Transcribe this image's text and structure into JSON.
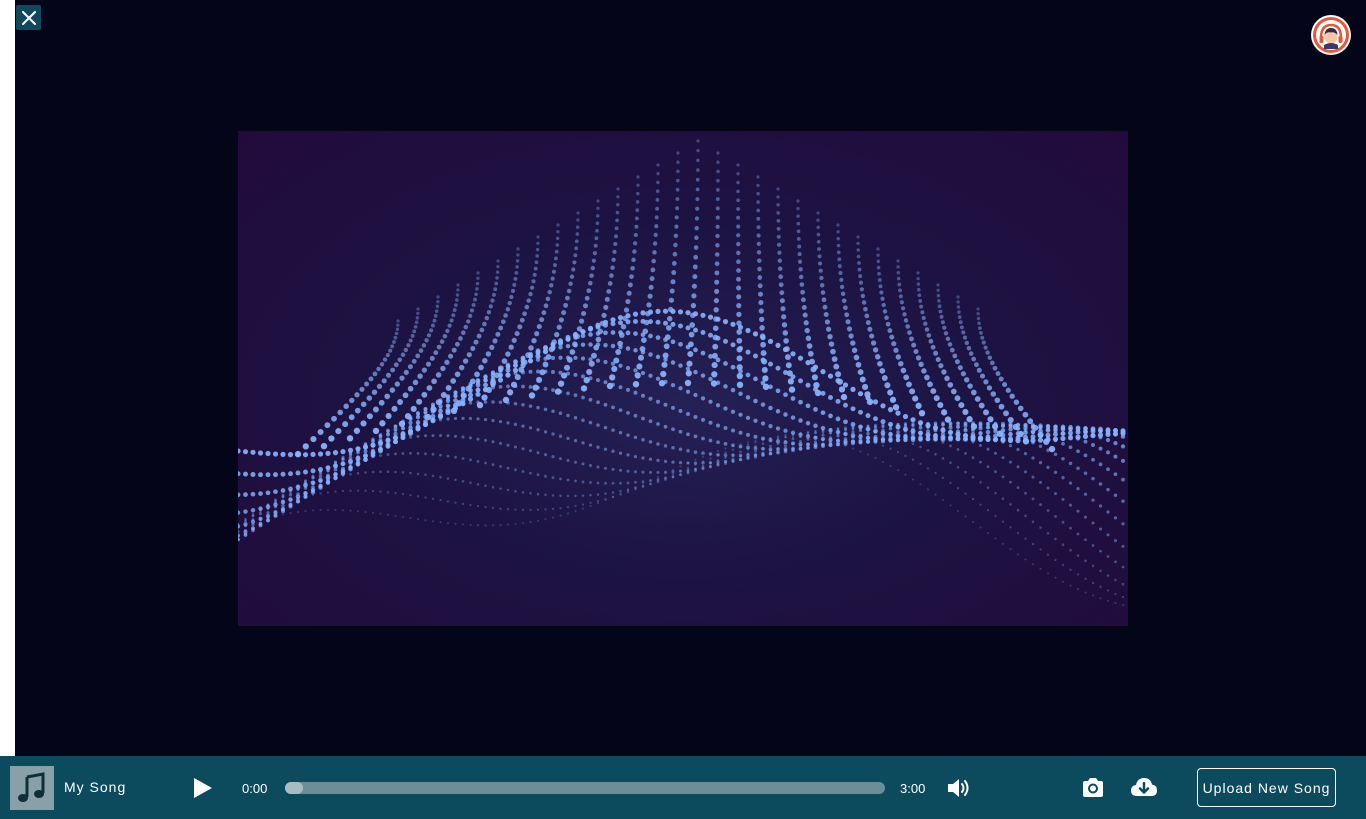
{
  "window": {
    "close_icon": "close-icon",
    "avatar_icon": "headphones-avatar-icon"
  },
  "visualizer": {
    "style": "particle-wave",
    "colors": {
      "background": "#1c1342",
      "particle": "#8ab4ff"
    }
  },
  "player": {
    "song_title": "My Song",
    "song_icon": "music-note-icon",
    "current_time": "0:00",
    "total_time": "3:00",
    "progress_fraction": 0.03,
    "play_icon": "play-icon",
    "volume_icon": "volume-icon",
    "snapshot_icon": "camera-icon",
    "download_icon": "cloud-download-icon",
    "upload_label": "Upload New Song"
  },
  "colors": {
    "accent": "#0c4a5e",
    "stage_background": "#05051a"
  }
}
